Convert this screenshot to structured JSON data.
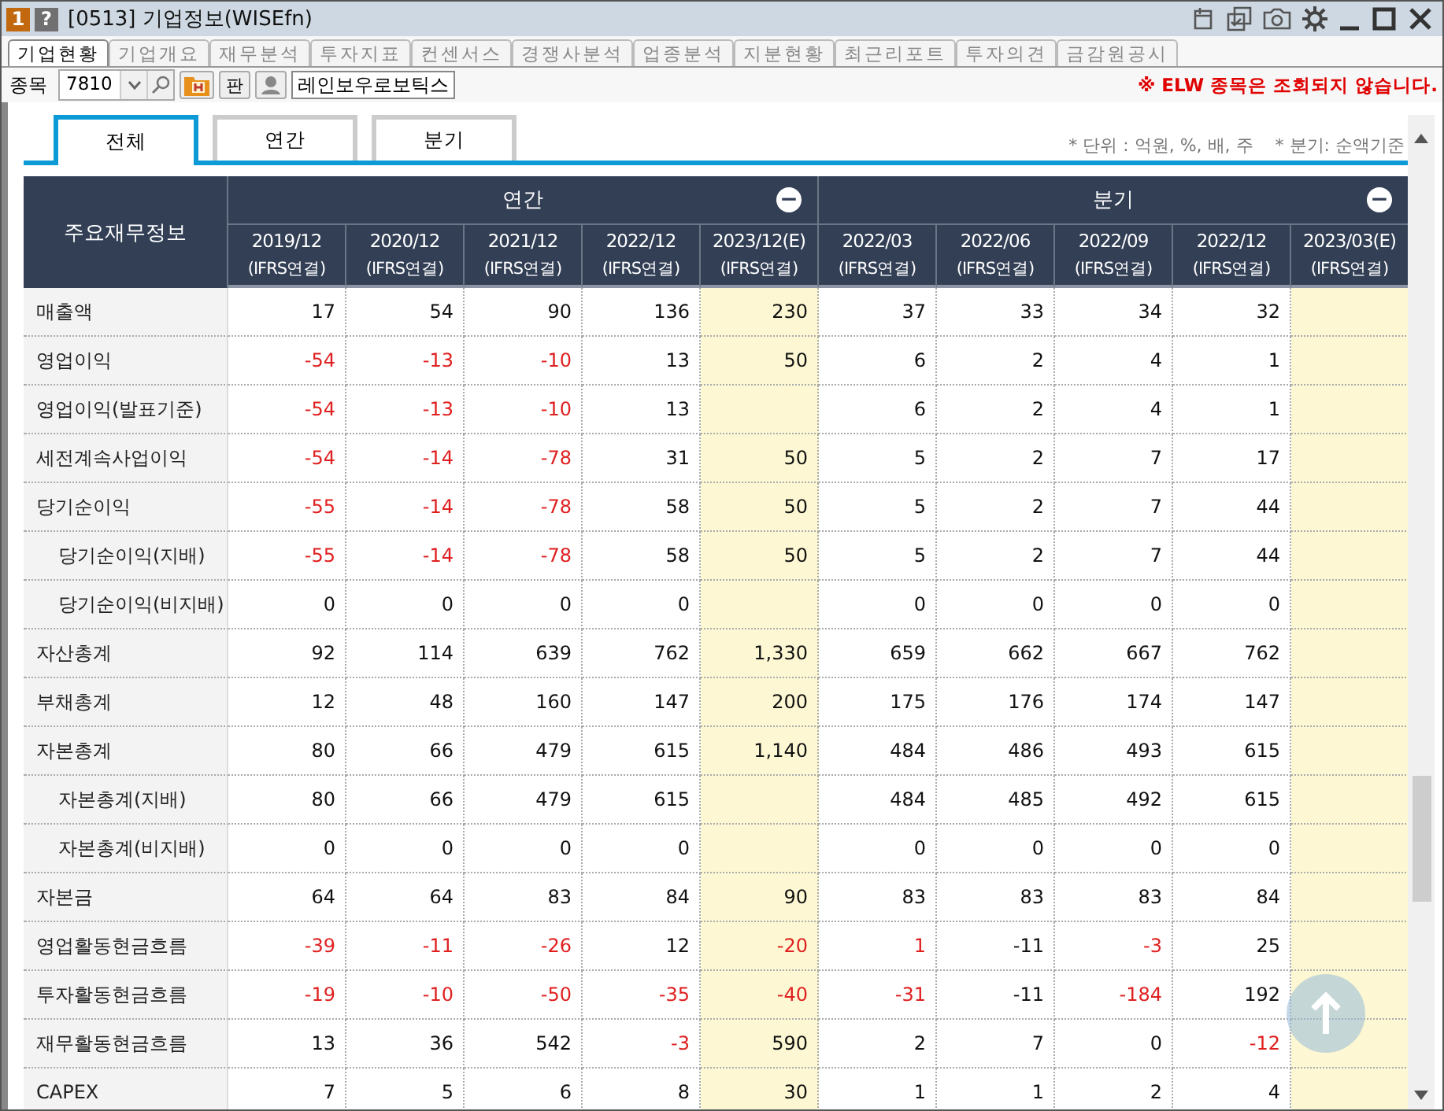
{
  "window": {
    "badge_number": "1",
    "help": "?",
    "title": "[0513] 기업정보(WISEfn)"
  },
  "tabs": [
    {
      "label": "기업현황",
      "selected": true
    },
    {
      "label": "기업개요",
      "selected": false
    },
    {
      "label": "재무분석",
      "selected": false
    },
    {
      "label": "투자지표",
      "selected": false
    },
    {
      "label": "컨센서스",
      "selected": false
    },
    {
      "label": "경쟁사분석",
      "selected": false
    },
    {
      "label": "업종분석",
      "selected": false
    },
    {
      "label": "지분현황",
      "selected": false
    },
    {
      "label": "최근리포트",
      "selected": false
    },
    {
      "label": "투자의견",
      "selected": false
    },
    {
      "label": "금감원공시",
      "selected": false
    }
  ],
  "toolbar": {
    "label": "종목",
    "code": "7810",
    "pan_button": "판",
    "company": "레인보우로보틱스",
    "notice": "※ ELW 종목은 조회되지 않습니다."
  },
  "subtabs": [
    {
      "label": "전체",
      "selected": true
    },
    {
      "label": "연간",
      "selected": false
    },
    {
      "label": "분기",
      "selected": false
    }
  ],
  "notes": [
    "* 단위 : 억원, %, 배, 주",
    "* 분기: 순액기준"
  ],
  "table": {
    "corner": "주요재무정보",
    "groups": [
      {
        "label": "연간",
        "collapse": "−"
      },
      {
        "label": "분기",
        "collapse": "−"
      }
    ],
    "columns": [
      {
        "period": "2019/12",
        "basis": "(IFRS연결)",
        "estimate": false
      },
      {
        "period": "2020/12",
        "basis": "(IFRS연결)",
        "estimate": false
      },
      {
        "period": "2021/12",
        "basis": "(IFRS연결)",
        "estimate": false
      },
      {
        "period": "2022/12",
        "basis": "(IFRS연결)",
        "estimate": false
      },
      {
        "period": "2023/12(E)",
        "basis": "(IFRS연결)",
        "estimate": true
      },
      {
        "period": "2022/03",
        "basis": "(IFRS연결)",
        "estimate": false
      },
      {
        "period": "2022/06",
        "basis": "(IFRS연결)",
        "estimate": false
      },
      {
        "period": "2022/09",
        "basis": "(IFRS연결)",
        "estimate": false
      },
      {
        "period": "2022/12",
        "basis": "(IFRS연결)",
        "estimate": false
      },
      {
        "period": "2023/03(E)",
        "basis": "(IFRS연결)",
        "estimate": true
      }
    ],
    "rows": [
      {
        "label": "매출액",
        "sub": false,
        "cells": [
          {
            "text": "17",
            "red": false
          },
          {
            "text": "54",
            "red": false
          },
          {
            "text": "90",
            "red": false
          },
          {
            "text": "136",
            "red": false
          },
          {
            "text": "230",
            "red": false
          },
          {
            "text": "37",
            "red": false
          },
          {
            "text": "33",
            "red": false
          },
          {
            "text": "34",
            "red": false
          },
          {
            "text": "32",
            "red": false
          },
          null
        ]
      },
      {
        "label": "영업이익",
        "sub": false,
        "cells": [
          {
            "text": "-54",
            "red": true
          },
          {
            "text": "-13",
            "red": true
          },
          {
            "text": "-10",
            "red": true
          },
          {
            "text": "13",
            "red": false
          },
          {
            "text": "50",
            "red": false
          },
          {
            "text": "6",
            "red": false
          },
          {
            "text": "2",
            "red": false
          },
          {
            "text": "4",
            "red": false
          },
          {
            "text": "1",
            "red": false
          },
          null
        ]
      },
      {
        "label": "영업이익(발표기준)",
        "sub": false,
        "cells": [
          {
            "text": "-54",
            "red": true
          },
          {
            "text": "-13",
            "red": true
          },
          {
            "text": "-10",
            "red": true
          },
          {
            "text": "13",
            "red": false
          },
          null,
          {
            "text": "6",
            "red": false
          },
          {
            "text": "2",
            "red": false
          },
          {
            "text": "4",
            "red": false
          },
          {
            "text": "1",
            "red": false
          },
          null
        ]
      },
      {
        "label": "세전계속사업이익",
        "sub": false,
        "cells": [
          {
            "text": "-54",
            "red": true
          },
          {
            "text": "-14",
            "red": true
          },
          {
            "text": "-78",
            "red": true
          },
          {
            "text": "31",
            "red": false
          },
          {
            "text": "50",
            "red": false
          },
          {
            "text": "5",
            "red": false
          },
          {
            "text": "2",
            "red": false
          },
          {
            "text": "7",
            "red": false
          },
          {
            "text": "17",
            "red": false
          },
          null
        ]
      },
      {
        "label": "당기순이익",
        "sub": false,
        "cells": [
          {
            "text": "-55",
            "red": true
          },
          {
            "text": "-14",
            "red": true
          },
          {
            "text": "-78",
            "red": true
          },
          {
            "text": "58",
            "red": false
          },
          {
            "text": "50",
            "red": false
          },
          {
            "text": "5",
            "red": false
          },
          {
            "text": "2",
            "red": false
          },
          {
            "text": "7",
            "red": false
          },
          {
            "text": "44",
            "red": false
          },
          null
        ]
      },
      {
        "label": "당기순이익(지배)",
        "sub": true,
        "cells": [
          {
            "text": "-55",
            "red": true
          },
          {
            "text": "-14",
            "red": true
          },
          {
            "text": "-78",
            "red": true
          },
          {
            "text": "58",
            "red": false
          },
          {
            "text": "50",
            "red": false
          },
          {
            "text": "5",
            "red": false
          },
          {
            "text": "2",
            "red": false
          },
          {
            "text": "7",
            "red": false
          },
          {
            "text": "44",
            "red": false
          },
          null
        ]
      },
      {
        "label": "당기순이익(비지배)",
        "sub": true,
        "cells": [
          {
            "text": "0",
            "red": false
          },
          {
            "text": "0",
            "red": false
          },
          {
            "text": "0",
            "red": false
          },
          {
            "text": "0",
            "red": false
          },
          null,
          {
            "text": "0",
            "red": false
          },
          {
            "text": "0",
            "red": false
          },
          {
            "text": "0",
            "red": false
          },
          {
            "text": "0",
            "red": false
          },
          null
        ]
      },
      {
        "label": "자산총계",
        "sub": false,
        "cells": [
          {
            "text": "92",
            "red": false
          },
          {
            "text": "114",
            "red": false
          },
          {
            "text": "639",
            "red": false
          },
          {
            "text": "762",
            "red": false
          },
          {
            "text": "1,330",
            "red": false
          },
          {
            "text": "659",
            "red": false
          },
          {
            "text": "662",
            "red": false
          },
          {
            "text": "667",
            "red": false
          },
          {
            "text": "762",
            "red": false
          },
          null
        ]
      },
      {
        "label": "부채총계",
        "sub": false,
        "cells": [
          {
            "text": "12",
            "red": false
          },
          {
            "text": "48",
            "red": false
          },
          {
            "text": "160",
            "red": false
          },
          {
            "text": "147",
            "red": false
          },
          {
            "text": "200",
            "red": false
          },
          {
            "text": "175",
            "red": false
          },
          {
            "text": "176",
            "red": false
          },
          {
            "text": "174",
            "red": false
          },
          {
            "text": "147",
            "red": false
          },
          null
        ]
      },
      {
        "label": "자본총계",
        "sub": false,
        "cells": [
          {
            "text": "80",
            "red": false
          },
          {
            "text": "66",
            "red": false
          },
          {
            "text": "479",
            "red": false
          },
          {
            "text": "615",
            "red": false
          },
          {
            "text": "1,140",
            "red": false
          },
          {
            "text": "484",
            "red": false
          },
          {
            "text": "486",
            "red": false
          },
          {
            "text": "493",
            "red": false
          },
          {
            "text": "615",
            "red": false
          },
          null
        ]
      },
      {
        "label": "자본총계(지배)",
        "sub": true,
        "cells": [
          {
            "text": "80",
            "red": false
          },
          {
            "text": "66",
            "red": false
          },
          {
            "text": "479",
            "red": false
          },
          {
            "text": "615",
            "red": false
          },
          null,
          {
            "text": "484",
            "red": false
          },
          {
            "text": "485",
            "red": false
          },
          {
            "text": "492",
            "red": false
          },
          {
            "text": "615",
            "red": false
          },
          null
        ]
      },
      {
        "label": "자본총계(비지배)",
        "sub": true,
        "cells": [
          {
            "text": "0",
            "red": false
          },
          {
            "text": "0",
            "red": false
          },
          {
            "text": "0",
            "red": false
          },
          {
            "text": "0",
            "red": false
          },
          null,
          {
            "text": "0",
            "red": false
          },
          {
            "text": "0",
            "red": false
          },
          {
            "text": "0",
            "red": false
          },
          {
            "text": "0",
            "red": false
          },
          null
        ]
      },
      {
        "label": "자본금",
        "sub": false,
        "cells": [
          {
            "text": "64",
            "red": false
          },
          {
            "text": "64",
            "red": false
          },
          {
            "text": "83",
            "red": false
          },
          {
            "text": "84",
            "red": false
          },
          {
            "text": "90",
            "red": false
          },
          {
            "text": "83",
            "red": false
          },
          {
            "text": "83",
            "red": false
          },
          {
            "text": "83",
            "red": false
          },
          {
            "text": "84",
            "red": false
          },
          null
        ]
      },
      {
        "label": "영업활동현금흐름",
        "sub": false,
        "cells": [
          {
            "text": "-39",
            "red": true
          },
          {
            "text": "-11",
            "red": true
          },
          {
            "text": "-26",
            "red": true
          },
          {
            "text": "12",
            "red": false
          },
          {
            "text": "-20",
            "red": true
          },
          {
            "text": "1",
            "red": true
          },
          {
            "text": "-11",
            "red": false
          },
          {
            "text": "-3",
            "red": true
          },
          {
            "text": "25",
            "red": false
          },
          null
        ]
      },
      {
        "label": "투자활동현금흐름",
        "sub": false,
        "cells": [
          {
            "text": "-19",
            "red": true
          },
          {
            "text": "-10",
            "red": true
          },
          {
            "text": "-50",
            "red": true
          },
          {
            "text": "-35",
            "red": true
          },
          {
            "text": "-40",
            "red": true
          },
          {
            "text": "-31",
            "red": true
          },
          {
            "text": "-11",
            "red": false
          },
          {
            "text": "-184",
            "red": true
          },
          {
            "text": "192",
            "red": false
          },
          null
        ]
      },
      {
        "label": "재무활동현금흐름",
        "sub": false,
        "cells": [
          {
            "text": "13",
            "red": false
          },
          {
            "text": "36",
            "red": false
          },
          {
            "text": "542",
            "red": false
          },
          {
            "text": "-3",
            "red": true
          },
          {
            "text": "590",
            "red": false
          },
          {
            "text": "2",
            "red": false
          },
          {
            "text": "7",
            "red": false
          },
          {
            "text": "0",
            "red": false
          },
          {
            "text": "-12",
            "red": true
          },
          null
        ]
      },
      {
        "label": "CAPEX",
        "sub": false,
        "cells": [
          {
            "text": "7",
            "red": false
          },
          {
            "text": "5",
            "red": false
          },
          {
            "text": "6",
            "red": false
          },
          {
            "text": "8",
            "red": false
          },
          {
            "text": "30",
            "red": false
          },
          {
            "text": "1",
            "red": false
          },
          {
            "text": "1",
            "red": false
          },
          {
            "text": "2",
            "red": false
          },
          {
            "text": "4",
            "red": false
          },
          null
        ]
      }
    ]
  }
}
